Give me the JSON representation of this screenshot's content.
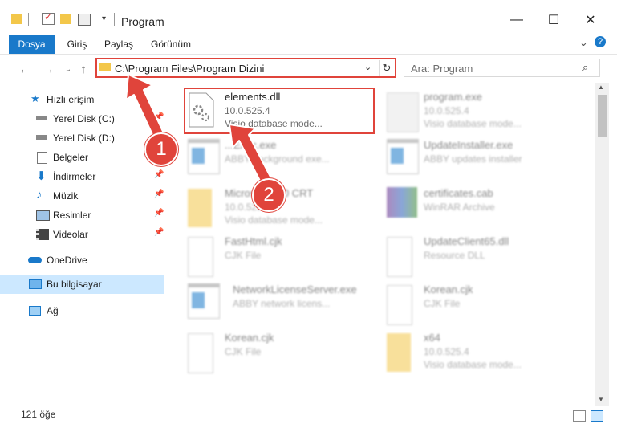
{
  "window": {
    "title": "Program",
    "minimize": "—",
    "maximize": "☐",
    "close": "✕"
  },
  "ribbon": {
    "tabs": [
      "Dosya",
      "Giriş",
      "Paylaş",
      "Görünüm"
    ],
    "expand": "⌄",
    "help": "?"
  },
  "address": {
    "path": "C:\\Program Files\\Program Dizini",
    "dropdown": "⌄",
    "refresh": "↻",
    "search_placeholder": "Ara: Program",
    "search_icon": "⌕"
  },
  "sidebar": {
    "items": [
      {
        "label": "Hızlı erişim",
        "icon": "star-icon"
      },
      {
        "label": "Yerel Disk (C:)",
        "icon": "drive-icon"
      },
      {
        "label": "Yerel Disk (D:)",
        "icon": "drive-icon"
      },
      {
        "label": "Belgeler",
        "icon": "documents-icon"
      },
      {
        "label": "İndirmeler",
        "icon": "download-icon"
      },
      {
        "label": "Müzik",
        "icon": "music-icon"
      },
      {
        "label": "Resimler",
        "icon": "pictures-icon"
      },
      {
        "label": "Videolar",
        "icon": "videos-icon"
      },
      {
        "label": "OneDrive",
        "icon": "cloud-icon"
      },
      {
        "label": "Bu bilgisayar",
        "icon": "computer-icon"
      },
      {
        "label": "Ağ",
        "icon": "network-icon"
      }
    ]
  },
  "files": [
    {
      "name": "elements.dll",
      "line1": "10.0.525.4",
      "line2": "Visio database mode..."
    },
    {
      "name": "program.exe",
      "line1": "10.0.525.4",
      "line2": "Visio database mode..."
    },
    {
      "name": "...Exec.exe",
      "line1": "ABBY background exe...",
      "line2": ""
    },
    {
      "name": "UpdateInstaller.exe",
      "line1": "ABBY updates installer",
      "line2": ""
    },
    {
      "name": "Microsoft C90 CRT",
      "line1": "10.0.525...",
      "line2": "Visio database mode..."
    },
    {
      "name": "certificates.cab",
      "line1": "WinRAR Archive",
      "line2": ""
    },
    {
      "name": "FastHtml.cjk",
      "line1": "CJK File",
      "line2": ""
    },
    {
      "name": "UpdateClient65.dll",
      "line1": "Resource DLL",
      "line2": ""
    },
    {
      "name": "NetworkLicenseServer.exe",
      "line1": "ABBY network licens...",
      "line2": ""
    },
    {
      "name": "Korean.cjk",
      "line1": "CJK File",
      "line2": ""
    },
    {
      "name": "Korean.cjk",
      "line1": "CJK File",
      "line2": ""
    },
    {
      "name": "x64",
      "line1": "10.0.525.4",
      "line2": "Visio database mode..."
    }
  ],
  "badges": [
    "1",
    "2"
  ],
  "status": "121 öğe",
  "colors": {
    "accent": "#1979ca",
    "highlight": "#e0443b",
    "selected": "#cce8ff"
  }
}
